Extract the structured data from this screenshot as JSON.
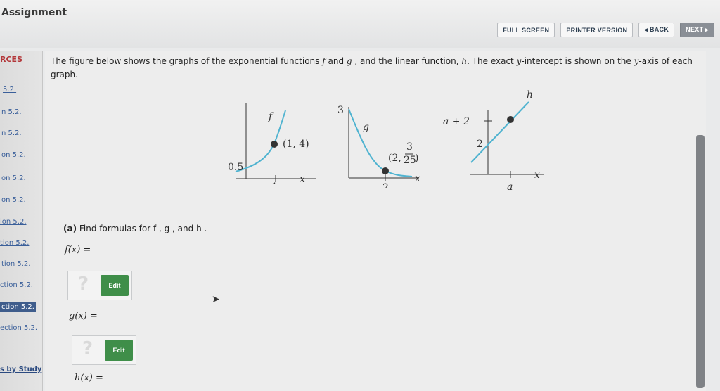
{
  "app": {
    "title": "Assignment"
  },
  "toolbar": {
    "full_screen": "FULL SCREEN",
    "printer_version": "PRINTER VERSION",
    "back": "◂ BACK",
    "next": "NEXT ▸"
  },
  "sidebar": {
    "heading": "RCES",
    "links": [
      "5.2.",
      "n 5.2.",
      "n 5.2.",
      "on 5.2.",
      "on 5.2.",
      "on 5.2.",
      "ion 5.2.",
      "tion 5.2.",
      "tion 5.2.",
      "ction 5.2.",
      "ction 5.2.",
      "ection 5.2."
    ],
    "active_index": 10,
    "study": "s by Study"
  },
  "question": {
    "prompt_before_f": "The figure below shows the graphs of the exponential functions ",
    "f": "f",
    "and1": " and ",
    "g": "g",
    "mid": " , and the linear function, ",
    "h": "h",
    "after_h": ". The exact ",
    "y1": "y",
    "intercept_text": "-intercept is shown on the ",
    "y2": "y",
    "axis_text": "-axis of each graph."
  },
  "graphs": {
    "f": {
      "name": "f",
      "intercept": "0.5",
      "point": "(1, 4)",
      "tick": "1",
      "axis": "x"
    },
    "g": {
      "name": "g",
      "intercept": "3",
      "point_prefix": "(2,",
      "point_num": "3",
      "point_den": "25",
      "point_suffix": ")",
      "tick": "2",
      "axis": "x"
    },
    "h": {
      "name": "h",
      "ylabel_top": "a + 2",
      "intercept": "2",
      "tick": "a",
      "axis": "x"
    }
  },
  "part_a": {
    "label": "(a)",
    "text": " Find formulas for f , g , and h .",
    "fx": "f(x) =",
    "gx": "g(x) =",
    "hx": "h(x) =",
    "edit": "Edit",
    "placeholder": "?"
  },
  "colors": {
    "curve": "#4fb3d0",
    "point": "#333333",
    "edit": "#3f8e49",
    "accent_red": "#b3373a"
  }
}
